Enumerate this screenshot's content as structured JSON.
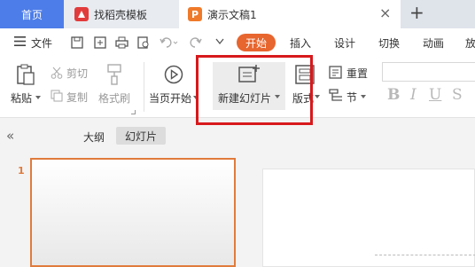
{
  "tabs": {
    "home": "首页",
    "template": "找稻壳模板",
    "doc": "演示文稿1",
    "close": "×",
    "add": "+"
  },
  "menu": {
    "file": "文件",
    "items": [
      "开始",
      "插入",
      "设计",
      "切换",
      "动画",
      "放"
    ],
    "active_color": "#e7652e"
  },
  "ribbon": {
    "paste": "粘贴",
    "cut": "剪切",
    "copy": "复制",
    "format_painter": "格式刷",
    "from_current": "当页开始",
    "new_slide": "新建幻灯片",
    "layout": "版式",
    "reset": "重置",
    "section": "节"
  },
  "sidebar": {
    "outline": "大纲",
    "slides": "幻灯片",
    "slide_number": "1"
  },
  "colors": {
    "accent": "#4d7de8",
    "highlight": "#d7191c"
  }
}
